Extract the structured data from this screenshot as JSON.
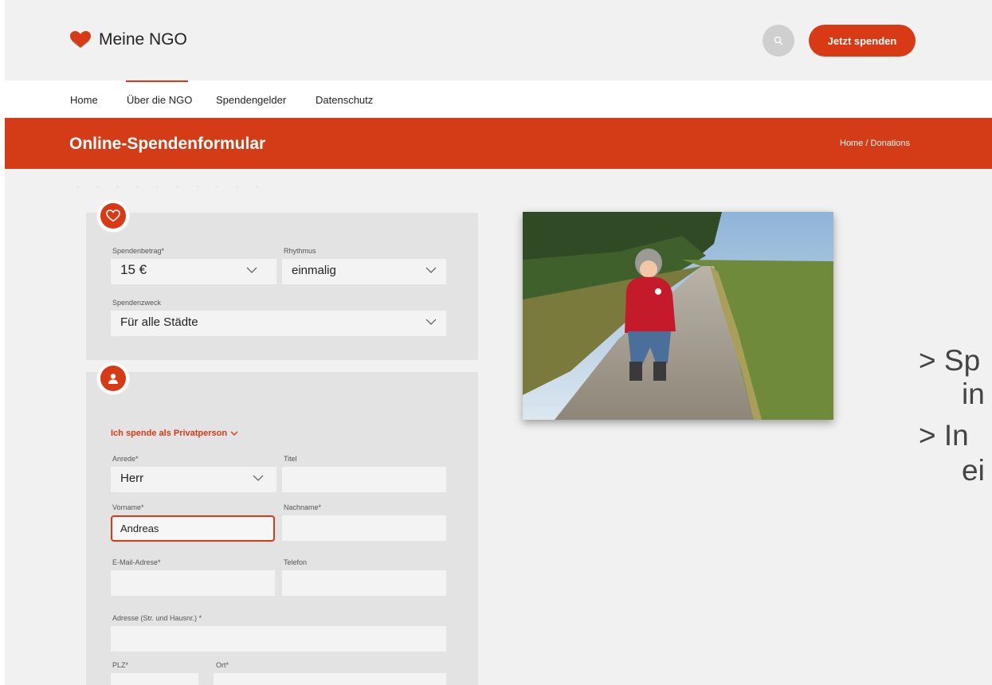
{
  "header": {
    "logo_text": "Meine NGO",
    "donate_button": "Jetzt spenden"
  },
  "nav": {
    "items": [
      "Home",
      "Über die NGO",
      "Spendengelder",
      "Datenschutz"
    ],
    "active_index": 1
  },
  "hero": {
    "title": "Online-Spendenformular",
    "breadcrumb": "Home / Donations"
  },
  "donation_card": {
    "amount_label": "Spendenbetrag*",
    "amount_value": "15 €",
    "rhythm_label": "Rhythmus",
    "rhythm_value": "einmalig",
    "purpose_label": "Spendenzweck",
    "purpose_value": "Für alle Städte"
  },
  "person_card": {
    "private_toggle": "Ich spende als Privatperson",
    "salutation_label": "Anrede*",
    "salutation_value": "Herr",
    "title_label": "Titel",
    "title_value": "",
    "firstname_label": "Vorname*",
    "firstname_value": "Andreas",
    "lastname_label": "Nachname*",
    "lastname_value": "",
    "email_label": "E-Mail-Adrese*",
    "email_value": "",
    "phone_label": "Telefon",
    "phone_value": "",
    "address_label": "Adresse (Str. und Hausnr.) *",
    "address_value": "",
    "zip_label": "PLZ*",
    "city_label": "Ort*"
  },
  "side_text": {
    "line1": "> Sp",
    "line2": "in",
    "line3": "> In",
    "line4": "ei"
  },
  "colors": {
    "accent": "#d93a16",
    "hero_bg": "#d33c17",
    "page_bg": "#f1f1f1",
    "card_bg": "#e3e3e3"
  },
  "icons": [
    "heart-logo-icon",
    "search-icon",
    "heart-outline-icon",
    "user-icon",
    "chevron-down-icon"
  ]
}
